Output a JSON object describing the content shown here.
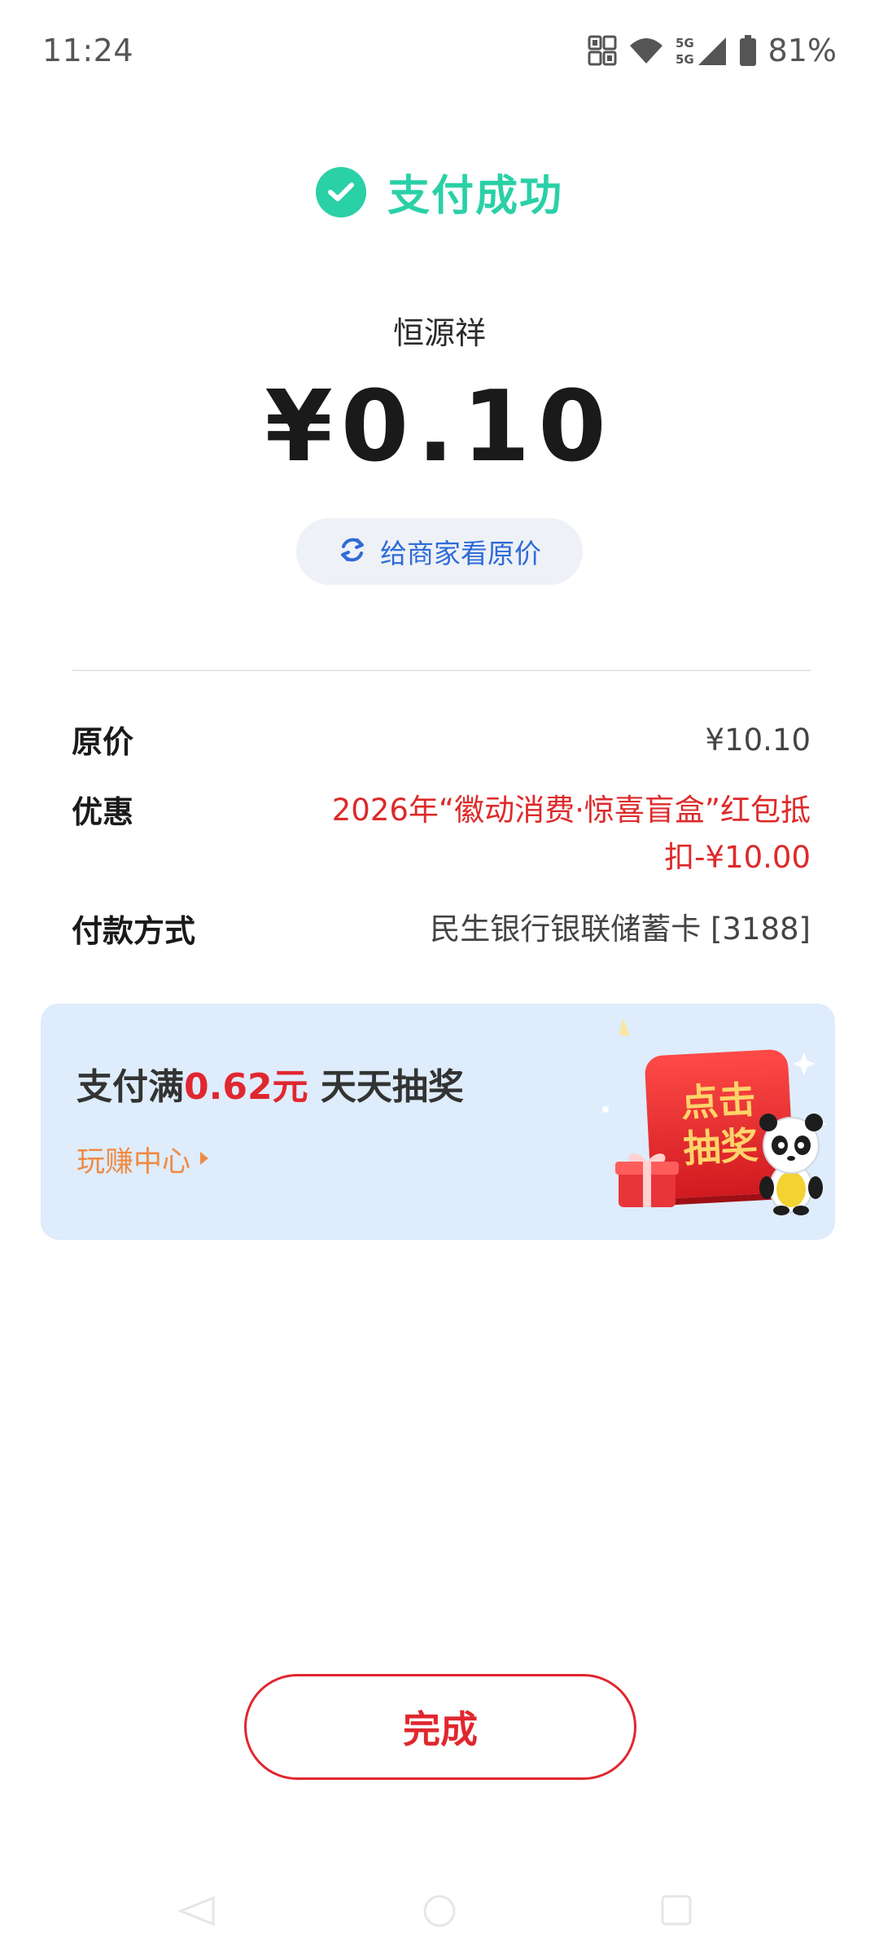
{
  "status_bar": {
    "time": "11:24",
    "battery": "81%",
    "icons": [
      "nfc-icon",
      "wifi-icon",
      "signal-5g-icon",
      "battery-icon"
    ]
  },
  "success": {
    "icon": "check-circle-icon",
    "text": "支付成功",
    "color": "#2ad0a6"
  },
  "merchant": "恒源祥",
  "amount": "¥0.10",
  "original_price_button": {
    "label": "给商家看原价",
    "icon": "refresh-icon",
    "color": "#2f6bd8"
  },
  "details": {
    "price": {
      "label": "原价",
      "value": "¥10.10"
    },
    "discount": {
      "label": "优惠",
      "value": "2026年“徽动消费·惊喜盲盒”红包抵扣-¥10.00"
    },
    "method": {
      "label": "付款方式",
      "value": "民生银行银联储蓄卡 [3188]"
    }
  },
  "promo": {
    "title_prefix": "支付满",
    "title_highlight": "0.62元",
    "title_suffix": " 天天抽奖",
    "link": "玩赚中心",
    "badge_line1": "点击",
    "badge_line2": "抽奖",
    "background": "#deecfb"
  },
  "done_button": {
    "label": "完成",
    "color": "#e0272f"
  }
}
